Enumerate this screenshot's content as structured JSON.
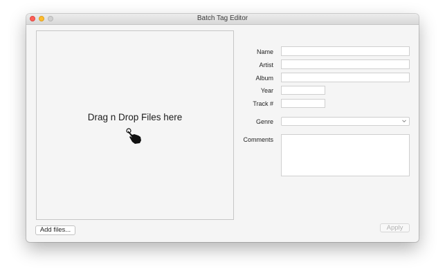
{
  "window": {
    "title": "Batch Tag Editor"
  },
  "dropzone": {
    "text": "Drag n Drop Files here"
  },
  "form": {
    "name": {
      "label": "Name",
      "value": ""
    },
    "artist": {
      "label": "Artist",
      "value": ""
    },
    "album": {
      "label": "Album",
      "value": ""
    },
    "year": {
      "label": "Year",
      "value": ""
    },
    "track": {
      "label": "Track #",
      "value": ""
    },
    "genre": {
      "label": "Genre",
      "value": ""
    },
    "comments": {
      "label": "Comments",
      "value": ""
    }
  },
  "buttons": {
    "add_files": "Add files...",
    "apply": "Apply"
  },
  "icons": {
    "drop": "hand-pointer-icon",
    "genre_dropdown": "chevron-down-icon"
  },
  "colors": {
    "close": "#fc5f57",
    "minimize": "#fdbc2e",
    "zoom_inactive": "#d0d0d0",
    "window_bg": "#f5f5f5"
  }
}
